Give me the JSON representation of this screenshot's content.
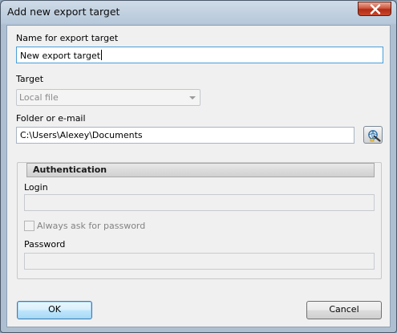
{
  "window": {
    "title": "Add new export target"
  },
  "name_field": {
    "label": "Name for export target",
    "value": "New export target"
  },
  "target": {
    "label": "Target",
    "selected": "Local file"
  },
  "folder": {
    "label": "Folder or e-mail",
    "value": "C:\\Users\\Alexey\\Documents"
  },
  "auth": {
    "header": "Authentication",
    "login_label": "Login",
    "login_value": "",
    "always_ask_label": "Always ask for password",
    "always_ask_checked": false,
    "password_label": "Password",
    "password_value": ""
  },
  "buttons": {
    "ok": "OK",
    "cancel": "Cancel"
  },
  "icons": {
    "close": "close-icon",
    "browse": "folder-browse-icon"
  },
  "colors": {
    "default_button_border": "#3c7fb1",
    "close_button": "#c9472d",
    "focus_border": "#4a9fd8"
  }
}
